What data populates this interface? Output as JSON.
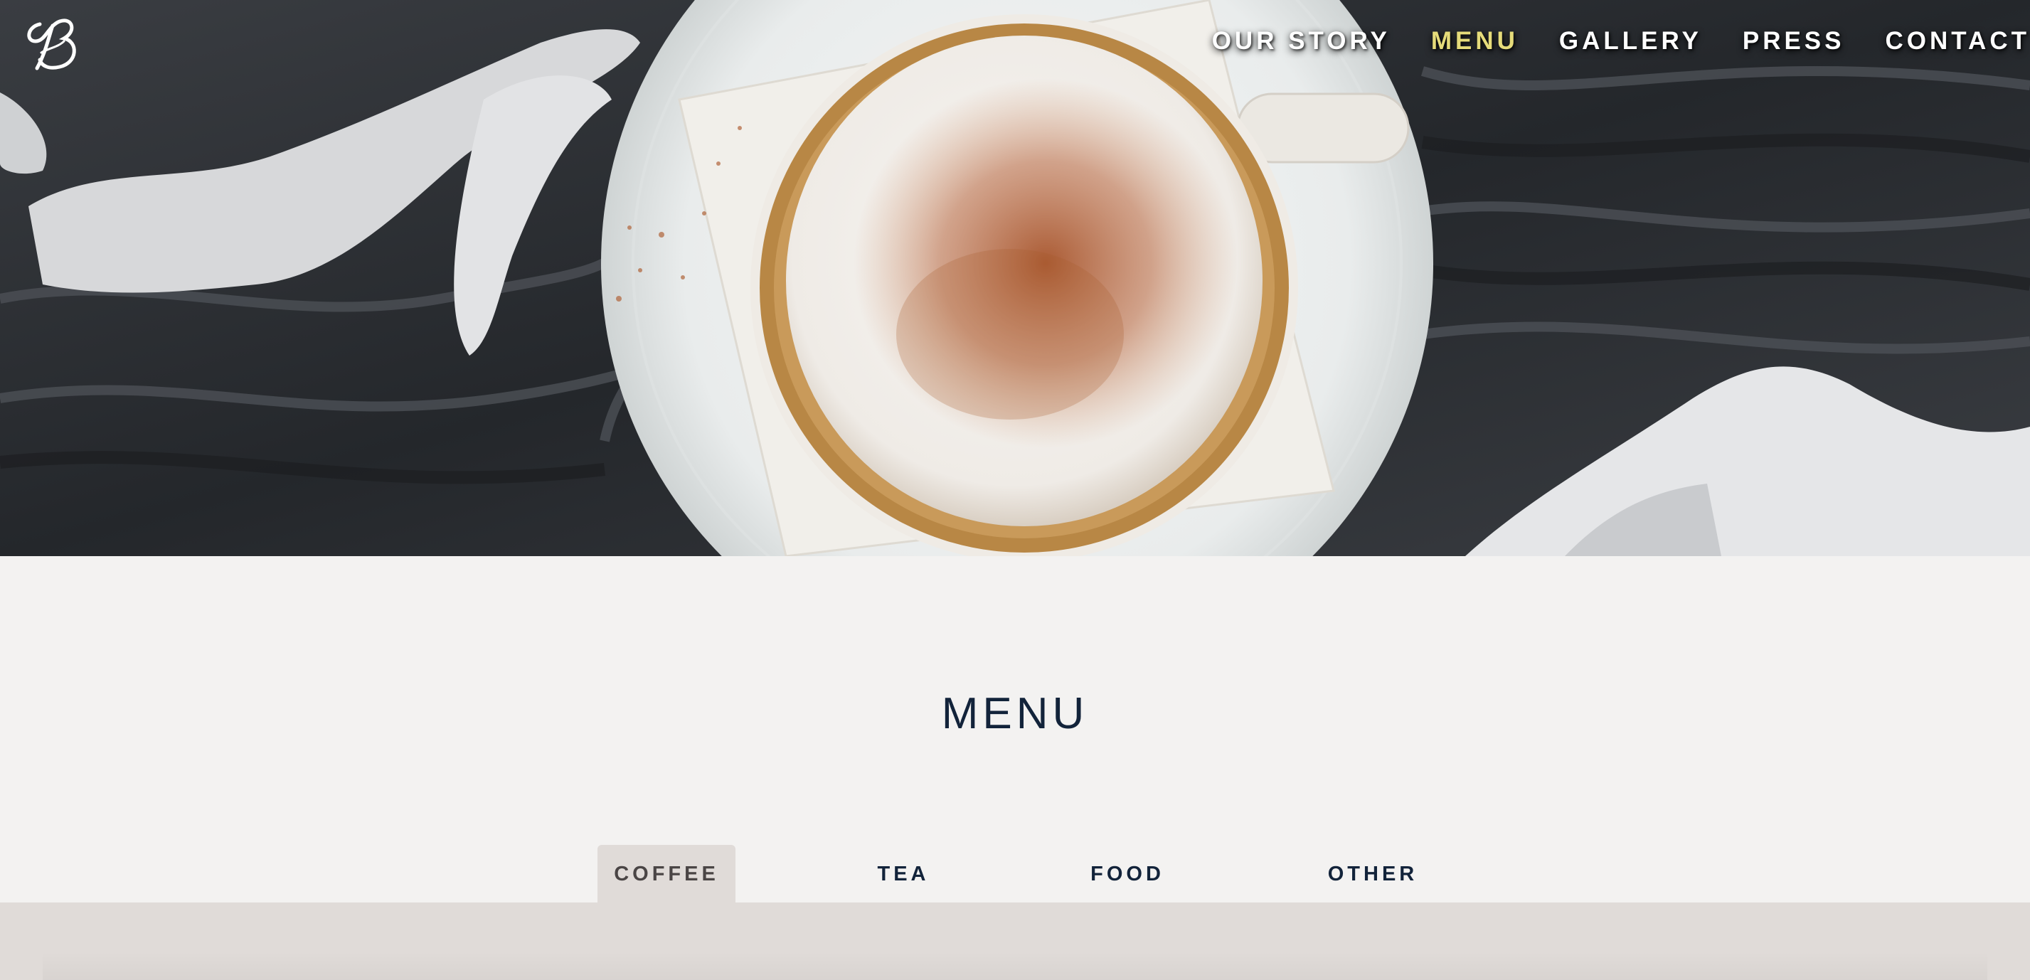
{
  "header": {
    "logo_icon": "script-b-logo",
    "nav": [
      {
        "label": "OUR STORY",
        "active": false
      },
      {
        "label": "MENU",
        "active": true
      },
      {
        "label": "GALLERY",
        "active": false
      },
      {
        "label": "PRESS",
        "active": false
      },
      {
        "label": "CONTACT",
        "active": false
      }
    ]
  },
  "hero": {
    "image": "cappuccino-on-marble-photo"
  },
  "menu": {
    "title": "MENU",
    "tabs": [
      {
        "label": "COFFEE",
        "active": true
      },
      {
        "label": "TEA",
        "active": false
      },
      {
        "label": "FOOD",
        "active": false
      },
      {
        "label": "OTHER",
        "active": false
      }
    ]
  },
  "colors": {
    "nav_active": "#e6dc7a",
    "nav_text": "#ffffff",
    "title": "#12233a",
    "page_bg": "#f3f2f1",
    "tab_active_bg": "#e0dbd8"
  }
}
